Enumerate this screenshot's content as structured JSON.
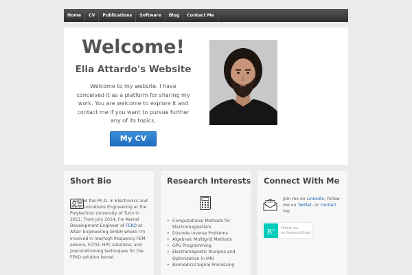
{
  "nav": {
    "items": [
      "Home",
      "CV",
      "Publications",
      "Software",
      "Blog",
      "Contact Me"
    ]
  },
  "hero": {
    "heading": "Welcome!",
    "subtitle": "Elia Attardo's Website",
    "intro": "Welcome to my website. I have conceived it as a platform for sharing my work. You are welcome to explore it and contact me if you want to pursue further any of its topics.",
    "cv_button": "My CV"
  },
  "bio": {
    "title": "Short Bio",
    "icon": "id-card-icon",
    "text_part1": "I earned the Ph.D. in Electronics and Communications Engineering at the Polytechnic University of Turin in 2011. From July 2014, I'm Kernel Development Engineer of ",
    "feko_link": "FEKO",
    "text_part2": " at Altair Engineering GmbH where I'm involved in low/high frequency FEM solvers, FDTD, HPC solutions, and preconditioning techniques for the FEKO solution kernel."
  },
  "research": {
    "title": "Research Interests",
    "icon": "calculator-icon",
    "items": [
      "Computational Methods for Electromagnetism",
      "Discrete Inverse Problems",
      "Algebraic Multigrid Methods",
      "GPU Programming",
      "Electromagnetic Analysis and Optimization in MRI",
      "Biomedical Signal Processing"
    ]
  },
  "connect": {
    "title": "Connect With Me",
    "icon": "envelope-icon",
    "t1": "Join me on ",
    "linkedin": "LinkedIn",
    "t2": ", follow me on ",
    "twitter": "Twitter",
    "t3": ", or ",
    "contact": "contact",
    "t4": " me.",
    "rg_logo": "R",
    "rg_sup": "G",
    "rg_line1": "Follow me",
    "rg_line2": "on ResearchGate"
  },
  "colors": {
    "accent": "#1f6fc1",
    "link": "#1a68b5",
    "researchgate": "#00ccbb"
  }
}
